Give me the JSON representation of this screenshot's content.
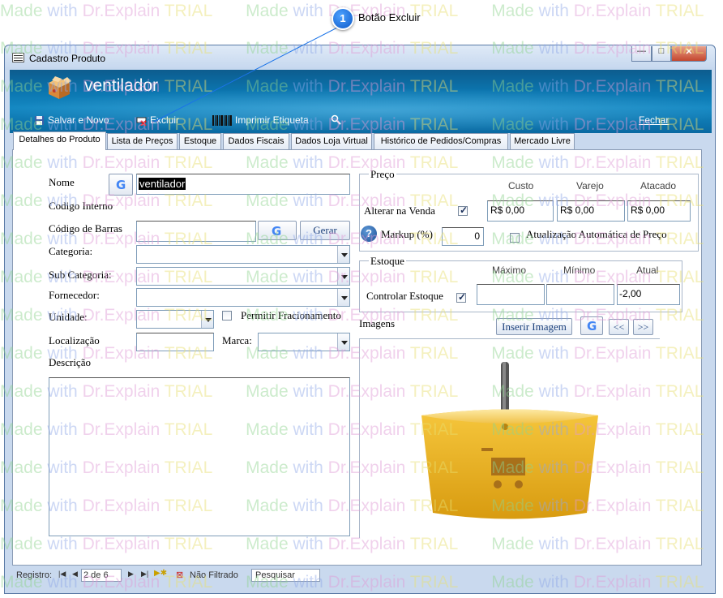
{
  "watermark": {
    "w1": "Made ",
    "w2": "with ",
    "w3": "Dr.Explain ",
    "w4": "TRIAL"
  },
  "callout": {
    "number": "1",
    "text": "Botão Excluir"
  },
  "window": {
    "title": "Cadastro Produto",
    "minimize": "—",
    "maximize": "□",
    "close": "✕"
  },
  "header": {
    "title": "ventilador",
    "toolbar": {
      "save_new": "Salvar e Novo",
      "delete": "Excluir",
      "print_label": "Imprimir Etiqueta",
      "close": "Fechar"
    }
  },
  "tabs": [
    "Detalhes do Produto",
    "Lista de Preços",
    "Estoque",
    "Dados Fiscais",
    "Dados Loja Virtual",
    "Histórico de Pedidos/Compras",
    "Mercado Livre"
  ],
  "form": {
    "nome_label": "Nome",
    "nome_value": "ventilador",
    "codigo_interno_label": "Codigo Interno",
    "codigo_barras_label": "Código de Barras",
    "gerar": "Gerar",
    "categoria_label": "Categoria:",
    "subcategoria_label": "Sub Categoria:",
    "fornecedor_label": "Fornecedor:",
    "unidade_label": "Unidade:",
    "permitir_fracionamento": "Permitir Fracionamento",
    "localizacao_label": "Localização",
    "marca_label": "Marca:",
    "descricao_label": "Descrição",
    "google_letter": "G"
  },
  "preco": {
    "title": "Preço",
    "custo": "Custo",
    "varejo": "Varejo",
    "atacado": "Atacado",
    "alterar_na_venda": "Alterar na Venda",
    "custo_value": "R$ 0,00",
    "varejo_value": "R$ 0,00",
    "atacado_value": "R$ 0,00",
    "markup_label": "Markup (%)",
    "markup_value": "0",
    "help": "?",
    "atualizacao_auto": "Atualização Automática de Preço"
  },
  "estoque": {
    "title": "Estoque",
    "maximo": "Máximo",
    "minimo": "Mínimo",
    "atual": "Atual",
    "controlar": "Controlar Estoque",
    "atual_value": "-2,00"
  },
  "imagens": {
    "label": "Imagens",
    "inserir": "Inserir Imagem",
    "prev": "<<",
    "next": ">>"
  },
  "status": {
    "registro": "Registro:",
    "record": "2 de 6",
    "filter": "Não Filtrado",
    "search": "Pesquisar"
  }
}
